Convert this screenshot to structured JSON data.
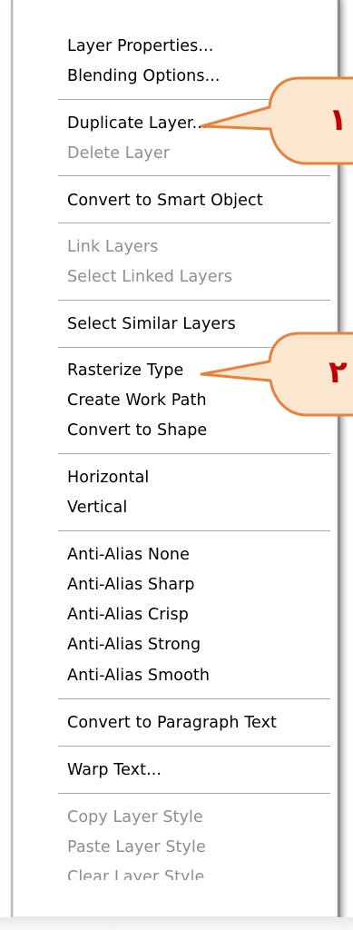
{
  "menu": {
    "items": [
      {
        "label": "Layer Properties...",
        "disabled": false
      },
      {
        "label": "Blending Options...",
        "disabled": false
      },
      {
        "label": "Duplicate Layer...",
        "disabled": false
      },
      {
        "label": "Delete Layer",
        "disabled": true
      },
      {
        "label": "Convert to Smart Object",
        "disabled": false
      },
      {
        "label": "Link Layers",
        "disabled": true
      },
      {
        "label": "Select Linked Layers",
        "disabled": true
      },
      {
        "label": "Select Similar Layers",
        "disabled": false
      },
      {
        "label": "Rasterize Type",
        "disabled": false
      },
      {
        "label": "Create Work Path",
        "disabled": false
      },
      {
        "label": "Convert to Shape",
        "disabled": false
      },
      {
        "label": "Horizontal",
        "disabled": false
      },
      {
        "label": "Vertical",
        "disabled": false
      },
      {
        "label": "Anti-Alias None",
        "disabled": false
      },
      {
        "label": "Anti-Alias Sharp",
        "disabled": false
      },
      {
        "label": "Anti-Alias Crisp",
        "disabled": false
      },
      {
        "label": "Anti-Alias Strong",
        "disabled": false
      },
      {
        "label": "Anti-Alias Smooth",
        "disabled": false
      },
      {
        "label": "Convert to Paragraph Text",
        "disabled": false
      },
      {
        "label": "Warp Text...",
        "disabled": false
      },
      {
        "label": "Copy Layer Style",
        "disabled": true
      },
      {
        "label": "Paste Layer Style",
        "disabled": true
      },
      {
        "label": "Clear Layer Style",
        "disabled": true
      }
    ]
  },
  "callouts": {
    "first": {
      "number": "١"
    },
    "second": {
      "number": "٢"
    }
  },
  "colors": {
    "callout_stroke": "#e8823a",
    "callout_fill": "#fbe6cf",
    "callout_text": "#c00000",
    "disabled_text": "#8e8e8e"
  }
}
